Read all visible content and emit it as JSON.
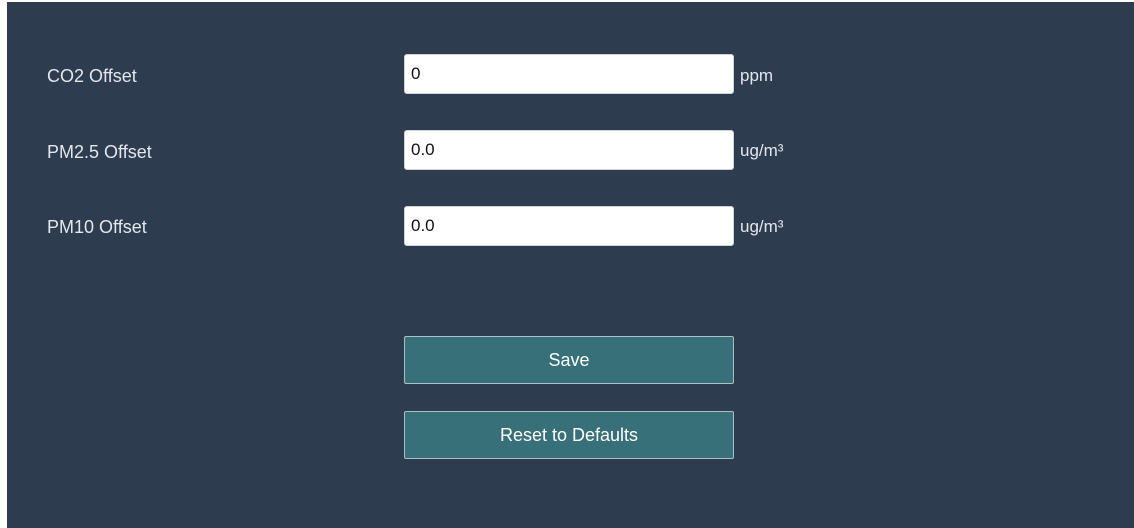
{
  "settings": {
    "co2": {
      "label": "CO2 Offset",
      "value": "0",
      "unit": "ppm"
    },
    "pm25": {
      "label": "PM2.5 Offset",
      "value": "0.0",
      "unit": "ug/m³"
    },
    "pm10": {
      "label": "PM10 Offset",
      "value": "0.0",
      "unit": "ug/m³"
    }
  },
  "actions": {
    "save_label": "Save",
    "reset_label": "Reset to Defaults"
  },
  "colors": {
    "background": "#2e3c4f",
    "button": "#38707a",
    "text": "#e3e7ec"
  }
}
